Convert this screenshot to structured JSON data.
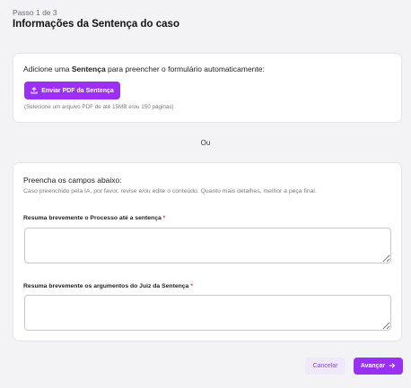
{
  "header": {
    "step": "Passo 1 de 3",
    "title": "Informações da Sentença do caso"
  },
  "upload_card": {
    "intro_prefix": "Adicione uma ",
    "intro_bold": "Sentença",
    "intro_suffix": " para preencher o formulário automaticamente:",
    "button_label": "Enviar PDF da Sentença",
    "button_icon": "upload-icon",
    "hint": "(Selecione um arquivo PDF de até 15MB e/ou 150 páginas)"
  },
  "separator": "Ou",
  "manual_card": {
    "title": "Preencha os campos abaixo:",
    "subtitle": "Caso preenchido pela IA, por favor, revise e/ou edite o conteúdo. Quanto mais detalhes, melhor a peça final.",
    "field1_label": "Resuma brevemente o Processo até a sentença",
    "field1_value": "",
    "field2_label": "Resuma brevemente os argumentos do Juiz da Sentença",
    "field2_value": "",
    "required_mark": "*"
  },
  "footer": {
    "cancel_label": "Cancelar",
    "next_label": "Avançar",
    "next_icon": "arrow-right-icon"
  },
  "colors": {
    "accent": "#9b30f5",
    "cancel_bg": "#f0e8fb",
    "required": "#e03a3a"
  }
}
